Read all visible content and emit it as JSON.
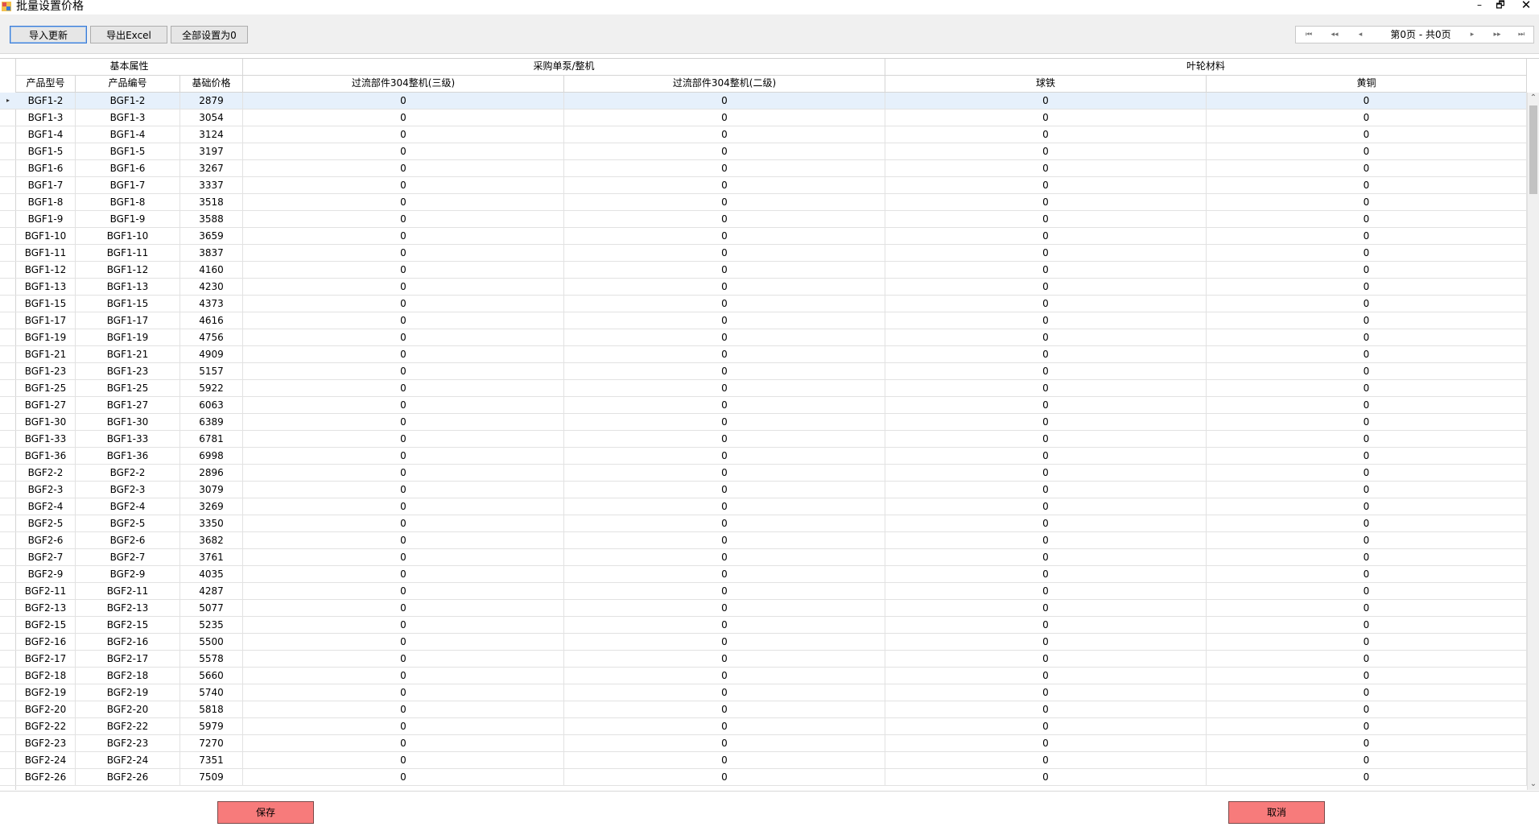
{
  "window": {
    "title": "批量设置价格",
    "minimize": "–",
    "maximize": "🗗",
    "close": "✕"
  },
  "toolbar": {
    "import_label": "导入更新",
    "export_label": "导出Excel",
    "zero_label": "全部设置为0"
  },
  "pager": {
    "first": "⏮",
    "prev_page": "◂◂",
    "prev": "◂",
    "info": "第0页 - 共0页",
    "next": "▸",
    "next_page": "▸▸",
    "last": "⏭"
  },
  "grid": {
    "group_headers": [
      "基本属性",
      "采购单泵/整机",
      "叶轮材料"
    ],
    "columns": [
      "产品型号",
      "产品编号",
      "基础价格",
      "过流部件304整机(三级)",
      "过流部件304整机(二级)",
      "球铁",
      "黄铜"
    ],
    "selected_row_marker": "▸",
    "rows": [
      [
        "BGF1-2",
        "BGF1-2",
        "2879",
        "0",
        "0",
        "0",
        "0"
      ],
      [
        "BGF1-3",
        "BGF1-3",
        "3054",
        "0",
        "0",
        "0",
        "0"
      ],
      [
        "BGF1-4",
        "BGF1-4",
        "3124",
        "0",
        "0",
        "0",
        "0"
      ],
      [
        "BGF1-5",
        "BGF1-5",
        "3197",
        "0",
        "0",
        "0",
        "0"
      ],
      [
        "BGF1-6",
        "BGF1-6",
        "3267",
        "0",
        "0",
        "0",
        "0"
      ],
      [
        "BGF1-7",
        "BGF1-7",
        "3337",
        "0",
        "0",
        "0",
        "0"
      ],
      [
        "BGF1-8",
        "BGF1-8",
        "3518",
        "0",
        "0",
        "0",
        "0"
      ],
      [
        "BGF1-9",
        "BGF1-9",
        "3588",
        "0",
        "0",
        "0",
        "0"
      ],
      [
        "BGF1-10",
        "BGF1-10",
        "3659",
        "0",
        "0",
        "0",
        "0"
      ],
      [
        "BGF1-11",
        "BGF1-11",
        "3837",
        "0",
        "0",
        "0",
        "0"
      ],
      [
        "BGF1-12",
        "BGF1-12",
        "4160",
        "0",
        "0",
        "0",
        "0"
      ],
      [
        "BGF1-13",
        "BGF1-13",
        "4230",
        "0",
        "0",
        "0",
        "0"
      ],
      [
        "BGF1-15",
        "BGF1-15",
        "4373",
        "0",
        "0",
        "0",
        "0"
      ],
      [
        "BGF1-17",
        "BGF1-17",
        "4616",
        "0",
        "0",
        "0",
        "0"
      ],
      [
        "BGF1-19",
        "BGF1-19",
        "4756",
        "0",
        "0",
        "0",
        "0"
      ],
      [
        "BGF1-21",
        "BGF1-21",
        "4909",
        "0",
        "0",
        "0",
        "0"
      ],
      [
        "BGF1-23",
        "BGF1-23",
        "5157",
        "0",
        "0",
        "0",
        "0"
      ],
      [
        "BGF1-25",
        "BGF1-25",
        "5922",
        "0",
        "0",
        "0",
        "0"
      ],
      [
        "BGF1-27",
        "BGF1-27",
        "6063",
        "0",
        "0",
        "0",
        "0"
      ],
      [
        "BGF1-30",
        "BGF1-30",
        "6389",
        "0",
        "0",
        "0",
        "0"
      ],
      [
        "BGF1-33",
        "BGF1-33",
        "6781",
        "0",
        "0",
        "0",
        "0"
      ],
      [
        "BGF1-36",
        "BGF1-36",
        "6998",
        "0",
        "0",
        "0",
        "0"
      ],
      [
        "BGF2-2",
        "BGF2-2",
        "2896",
        "0",
        "0",
        "0",
        "0"
      ],
      [
        "BGF2-3",
        "BGF2-3",
        "3079",
        "0",
        "0",
        "0",
        "0"
      ],
      [
        "BGF2-4",
        "BGF2-4",
        "3269",
        "0",
        "0",
        "0",
        "0"
      ],
      [
        "BGF2-5",
        "BGF2-5",
        "3350",
        "0",
        "0",
        "0",
        "0"
      ],
      [
        "BGF2-6",
        "BGF2-6",
        "3682",
        "0",
        "0",
        "0",
        "0"
      ],
      [
        "BGF2-7",
        "BGF2-7",
        "3761",
        "0",
        "0",
        "0",
        "0"
      ],
      [
        "BGF2-9",
        "BGF2-9",
        "4035",
        "0",
        "0",
        "0",
        "0"
      ],
      [
        "BGF2-11",
        "BGF2-11",
        "4287",
        "0",
        "0",
        "0",
        "0"
      ],
      [
        "BGF2-13",
        "BGF2-13",
        "5077",
        "0",
        "0",
        "0",
        "0"
      ],
      [
        "BGF2-15",
        "BGF2-15",
        "5235",
        "0",
        "0",
        "0",
        "0"
      ],
      [
        "BGF2-16",
        "BGF2-16",
        "5500",
        "0",
        "0",
        "0",
        "0"
      ],
      [
        "BGF2-17",
        "BGF2-17",
        "5578",
        "0",
        "0",
        "0",
        "0"
      ],
      [
        "BGF2-18",
        "BGF2-18",
        "5660",
        "0",
        "0",
        "0",
        "0"
      ],
      [
        "BGF2-19",
        "BGF2-19",
        "5740",
        "0",
        "0",
        "0",
        "0"
      ],
      [
        "BGF2-20",
        "BGF2-20",
        "5818",
        "0",
        "0",
        "0",
        "0"
      ],
      [
        "BGF2-22",
        "BGF2-22",
        "5979",
        "0",
        "0",
        "0",
        "0"
      ],
      [
        "BGF2-23",
        "BGF2-23",
        "7270",
        "0",
        "0",
        "0",
        "0"
      ],
      [
        "BGF2-24",
        "BGF2-24",
        "7351",
        "0",
        "0",
        "0",
        "0"
      ],
      [
        "BGF2-26",
        "BGF2-26",
        "7509",
        "0",
        "0",
        "0",
        "0"
      ]
    ]
  },
  "footer": {
    "save_label": "保存",
    "cancel_label": "取消"
  },
  "colors": {
    "action_button_bg": "#f77b7b",
    "selected_row_bg": "#e6f0fb",
    "grid_line": "#e2e2e2"
  }
}
